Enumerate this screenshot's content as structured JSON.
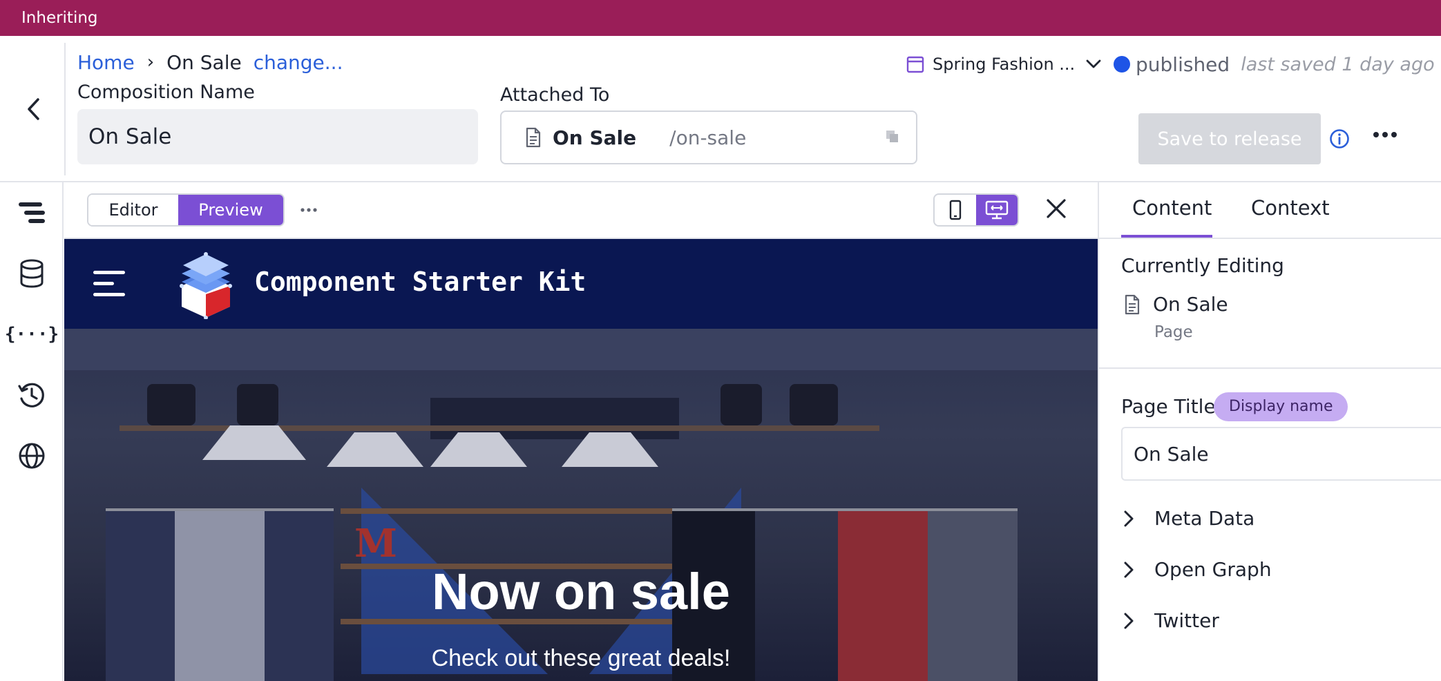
{
  "banner": {
    "text": "Inheriting"
  },
  "breadcrumb": {
    "home": "Home",
    "current": "On Sale",
    "change": "change..."
  },
  "composition": {
    "label": "Composition Name",
    "value": "On Sale"
  },
  "attached": {
    "label": "Attached To",
    "name": "On Sale",
    "path": "/on-sale"
  },
  "release": {
    "name": "Spring Fashion ..."
  },
  "status": {
    "state": "published",
    "saved": "last saved 1 day ago",
    "dot_color": "#1e54e6"
  },
  "actions": {
    "save_label": "Save to release"
  },
  "preview": {
    "editor_label": "Editor",
    "preview_label": "Preview",
    "site_title": "Component Starter Kit",
    "headline": "Now on sale",
    "subhead": "Check out these great deals!"
  },
  "panel": {
    "tabs": [
      "Content",
      "Context"
    ],
    "currently_editing": "Currently Editing",
    "item_name": "On Sale",
    "item_type": "Page",
    "page_title_label": "Page Title",
    "page_title_badge": "Display name",
    "page_title_value": "On Sale",
    "sections": [
      "Meta Data",
      "Open Graph",
      "Twitter"
    ]
  },
  "colors": {
    "banner": "#9a1e58",
    "accent": "#7b4fd4",
    "link": "#2b5fd9",
    "site_nav": "#0a1752"
  },
  "icons": {
    "sidebar": [
      "content-tree-icon",
      "database-icon",
      "json-braces-icon",
      "history-icon",
      "globe-icon"
    ]
  }
}
